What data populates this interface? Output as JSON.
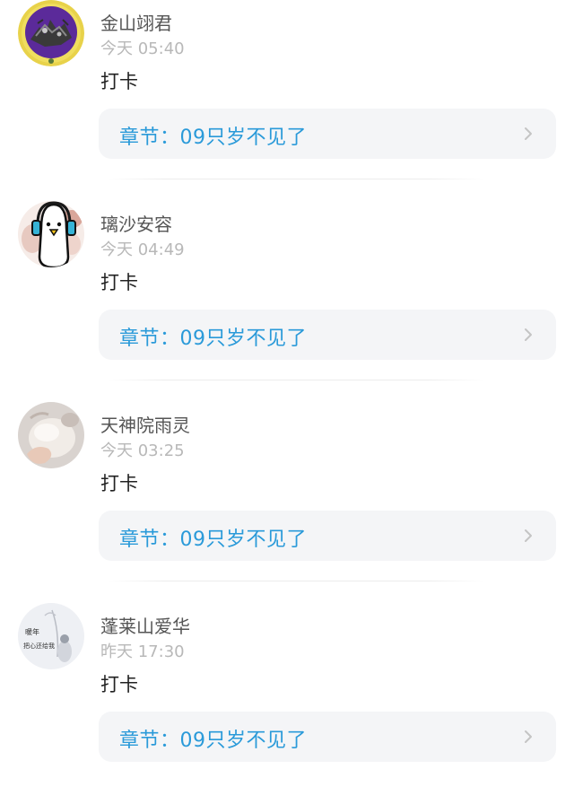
{
  "comments": [
    {
      "username": "金山翊君",
      "time": "今天 05:40",
      "content": "打卡",
      "chapter_label": "章节：09只岁不见了"
    },
    {
      "username": "璃沙安容",
      "time": "今天 04:49",
      "content": "打卡",
      "chapter_label": "章节：09只岁不见了"
    },
    {
      "username": "天神院雨灵",
      "time": "今天 03:25",
      "content": "打卡",
      "chapter_label": "章节：09只岁不见了"
    },
    {
      "username": "蓬莱山爱华",
      "time": "昨天 17:30",
      "content": "打卡",
      "chapter_label": "章节：09只岁不见了",
      "avatar_text": "暖年 把心还给我"
    }
  ],
  "colors": {
    "chapter_text": "#2a9ad9",
    "chapter_bg": "#f4f5f7",
    "username": "#555555",
    "timestamp": "#b8b8b8"
  },
  "icons": {
    "chapter_arrow": "chevron-right-icon"
  }
}
